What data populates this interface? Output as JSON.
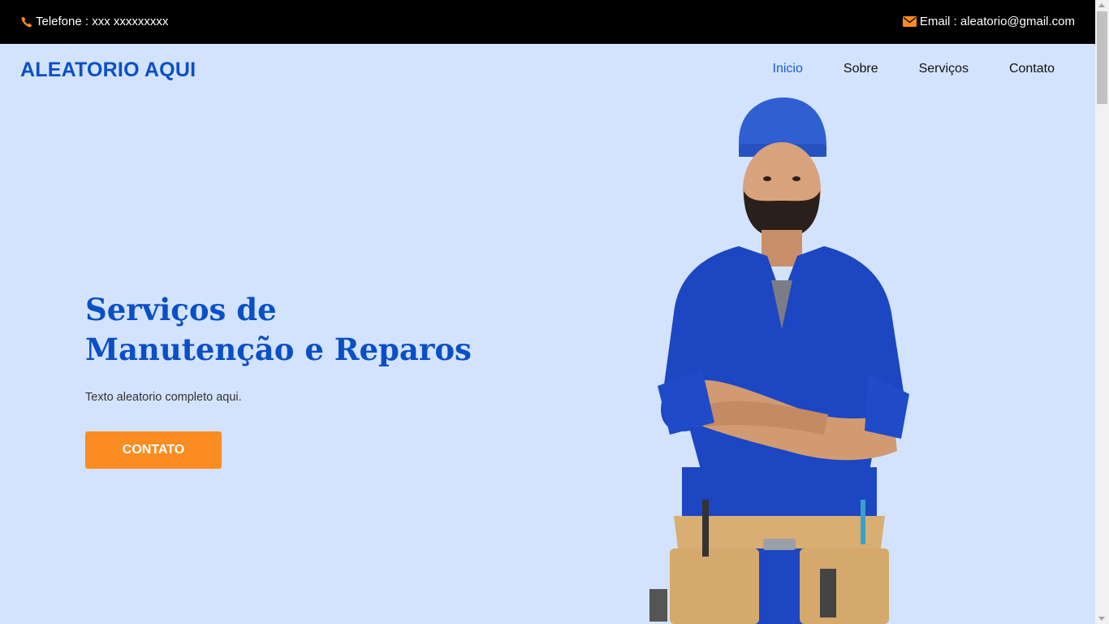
{
  "topbar": {
    "phone_text": "Telefone : xxx xxxxxxxxx",
    "email_text": "Email : aleatorio@gmail.com",
    "icon_color": "#fb8c22",
    "phone_icon": "phone-icon",
    "email_icon": "envelope-icon"
  },
  "navbar": {
    "brand": "ALEATORIO AQUI",
    "items": [
      {
        "label": "Inicio",
        "active": true
      },
      {
        "label": "Sobre"
      },
      {
        "label": "Serviços"
      },
      {
        "label": "Contato"
      }
    ]
  },
  "hero": {
    "title_line1": "Serviços de",
    "title_line2": "Manutenção e Reparos",
    "text": "Texto aleatorio completo aqui.",
    "button_label": "CONTATO",
    "title_color": "#0b4fc7",
    "button_color": "#fb8c22",
    "background": "#d3e3fd"
  }
}
